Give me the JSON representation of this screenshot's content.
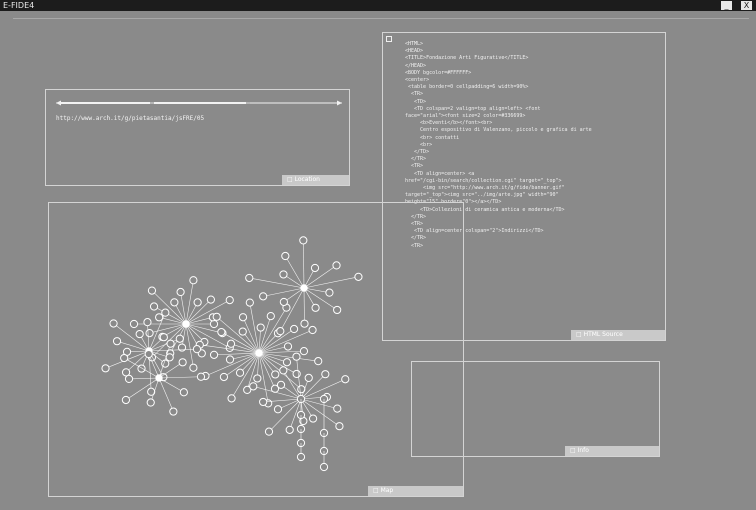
{
  "window": {
    "title": "E-FIDE4",
    "minimize_glyph": "_",
    "close_glyph": "X"
  },
  "url_panel": {
    "url": "http://www.arch.it/g/pietasantia/jsFRE/05",
    "tag": "□ Location"
  },
  "code_panel": {
    "icon": "page-icon",
    "tag": "□ HTML Source",
    "lines": [
      "<HTML>",
      "<HEAD>",
      "<TITLE>Fondazione Arti Figurative</TITLE>",
      "</HEAD>",
      "<BODY bgcolor=#FFFFFF>",
      "<center>",
      " <table border=0 cellpadding=6 width=90%>",
      "  <TR>",
      "   <TD>",
      "   <TD colspan=2 valign=top align=left> <font",
      "face=\"arial\"><font size=2 color=#336699>",
      "     <b>Eventi</b></font><br>",
      "     Centro espositivo di Valenzano, piccolo e grafica di arte",
      "     <br> contatti",
      "     <br>",
      "   </TD>",
      "  </TR>",
      "  <TR>",
      "   <TD align=center> <a",
      "href=\"/cgi-bin/search/collection.cgi\" target=\"_top\">",
      "      <img src=\"http://www.arch.it/g/fide/banner.gif\"",
      "target=\"_top\"><img src=\"../img/arte.jpg\" width=\"90\"",
      "height=\"15\" border=\"0\"></a></TD>",
      "     <TD>Collezioni di ceramica antica e moderna</TD>",
      "  </TR>",
      "  <TR>",
      "   <TD align=center colspan=\"2\">Indirizzi</TD>",
      "  </TR>",
      "  <TR>"
    ]
  },
  "graph_panel": {
    "tag": "□ Map"
  },
  "empty_panel": {
    "tag": "□ Info"
  },
  "colors": {
    "background": "#8a8a8a",
    "panel_border": "#d4d4d4",
    "tag": "#c9c9c9",
    "text": "#efefef"
  }
}
